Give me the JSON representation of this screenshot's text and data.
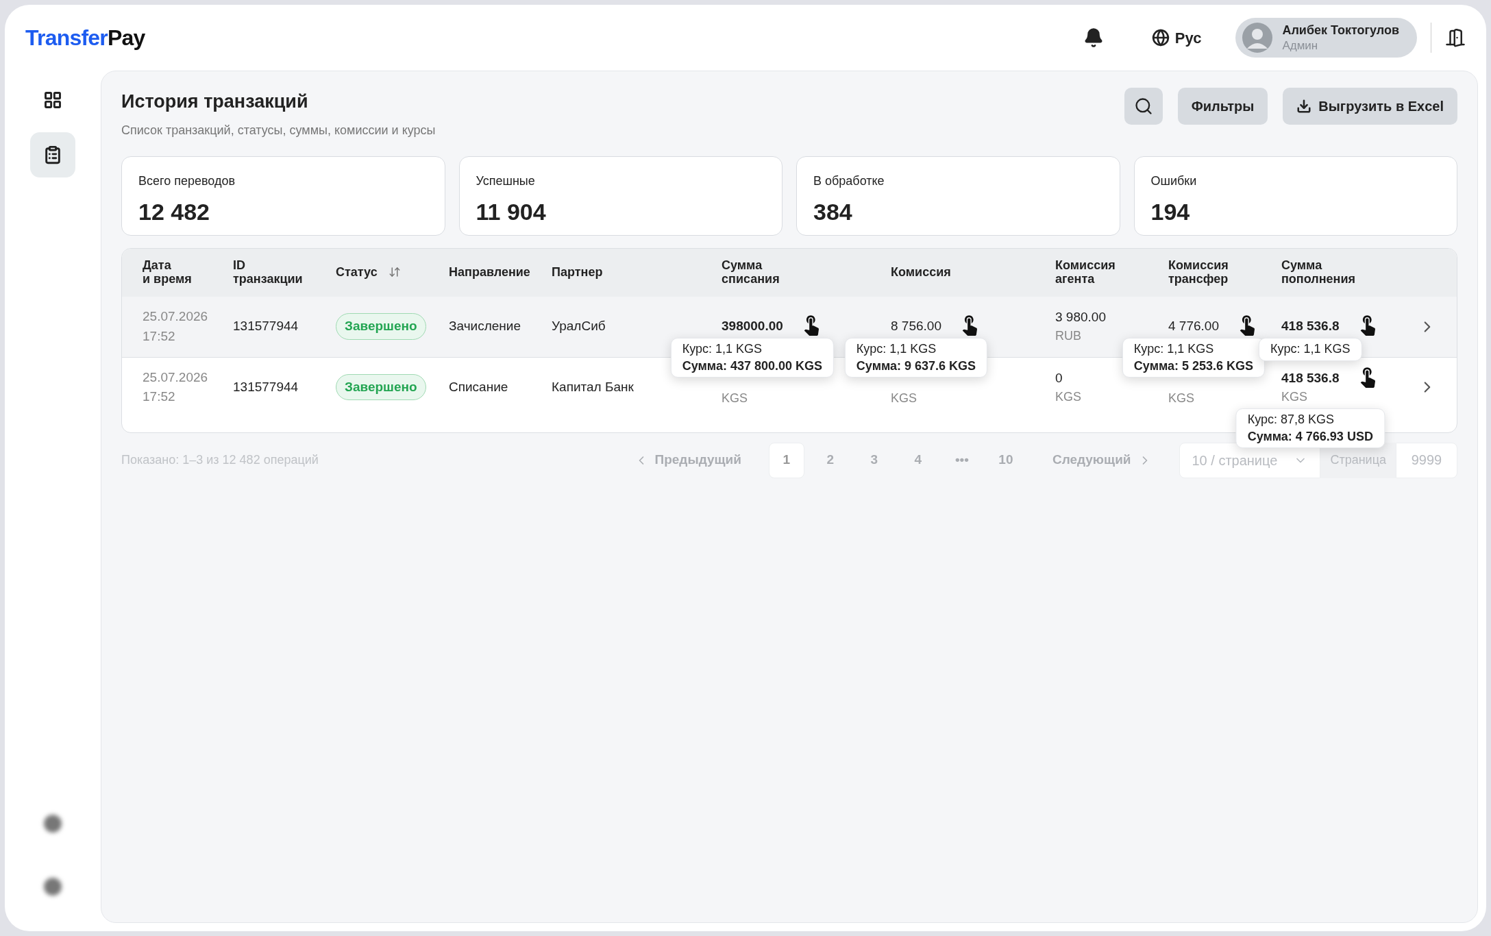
{
  "logo": {
    "first": "Transfer",
    "second": "Pay"
  },
  "header": {
    "language": "Рус",
    "user": {
      "name": "Алибек Токтогулов",
      "role": "Админ"
    }
  },
  "sidebar": {
    "items": [
      {
        "kind": "grid",
        "selected": false
      },
      {
        "kind": "clipboard",
        "selected": true
      }
    ],
    "bottom": [
      {
        "kind": "dot"
      },
      {
        "kind": "dot"
      }
    ]
  },
  "page": {
    "title": "История транзакций",
    "subtitle": "Список транзакций, статусы, суммы, комиссии и курсы",
    "filters": "Фильтры",
    "export": "Выгрузить в Excel"
  },
  "stats": [
    {
      "label": "Всего переводов",
      "value": "12 482"
    },
    {
      "label": "Успешные",
      "value": "11 904"
    },
    {
      "label": "В обработке",
      "value": "384"
    },
    {
      "label": "Ошибки",
      "value": "194"
    }
  ],
  "table": {
    "columns": [
      {
        "label": "Дата\nи время"
      },
      {
        "label": "ID\nтранзакции"
      },
      {
        "label": "Статус",
        "sortable": true
      },
      {
        "label": "Направление"
      },
      {
        "label": "Партнер"
      },
      {
        "label": "Сумма\nсписания"
      },
      {
        "label": "Комиссия"
      },
      {
        "label": "Комиссия\nагента"
      },
      {
        "label": "Комиссия\nтрансфер"
      },
      {
        "label": "Сумма\nпополнения"
      }
    ],
    "rows": [
      {
        "selected": true,
        "date": "25.07.2026",
        "time": "17:52",
        "id": "131577944",
        "status": {
          "label": "Завершено",
          "kind": "success"
        },
        "direction": "Зачисление",
        "partner": "УралСиб",
        "amounts": [
          {
            "amount": "398000.00",
            "bold": true,
            "tap": true,
            "tooltip": {
              "rate": "Курс: 1,1 KGS",
              "sum": "Сумма: 437 800.00 KGS"
            }
          },
          {
            "amount": "8 756.00",
            "bold": false,
            "tap": true,
            "tooltip": {
              "rate": "Курс: 1,1 KGS",
              "sum": "Сумма: 9 637.6 KGS"
            }
          },
          {
            "amount": "3 980.00",
            "currency": "RUB",
            "bold": false,
            "tap": false
          },
          {
            "amount": "4 776.00",
            "bold": false,
            "tap": true,
            "tooltip": {
              "rate": "Курс: 1,1 KGS",
              "sum": "Сумма: 5 253.6 KGS"
            }
          },
          {
            "amount": "418 536.8",
            "bold": true,
            "tap": true,
            "tooltip": {
              "rate": "Курс: 1,1 KGS"
            }
          }
        ]
      },
      {
        "selected": false,
        "date": "25.07.2026",
        "time": "17:52",
        "id": "131577944",
        "status": {
          "label": "Завершено",
          "kind": "success"
        },
        "direction": "Списание",
        "partner": "Капитал Банк",
        "amounts": [
          {
            "currency": "KGS",
            "tap": false
          },
          {
            "currency": "KGS",
            "tap": false
          },
          {
            "amount": "0",
            "currency": "KGS",
            "bold": false,
            "tap": false
          },
          {
            "currency": "KGS",
            "tap": false
          },
          {
            "amount": "418 536.8",
            "currency": "KGS",
            "bold": true,
            "tap": true,
            "tooltip": {
              "rate": "Курс: 87,8 KGS",
              "sum": "Сумма: 4 766.93 USD"
            }
          }
        ]
      }
    ]
  },
  "pagination": {
    "summary": "Показано: 1–3 из 12 482 операций",
    "previous": "Предыдущий",
    "next": "Следующий",
    "pages": [
      {
        "label": "1",
        "selected": true
      },
      {
        "label": "2",
        "selected": false
      },
      {
        "label": "3",
        "selected": false
      },
      {
        "label": "4",
        "selected": false
      },
      {
        "label": "•••",
        "selected": false
      },
      {
        "label": "10",
        "selected": false
      }
    ],
    "page_size": "10 / странице",
    "goto_label": "Страница",
    "goto_value": "9999"
  }
}
